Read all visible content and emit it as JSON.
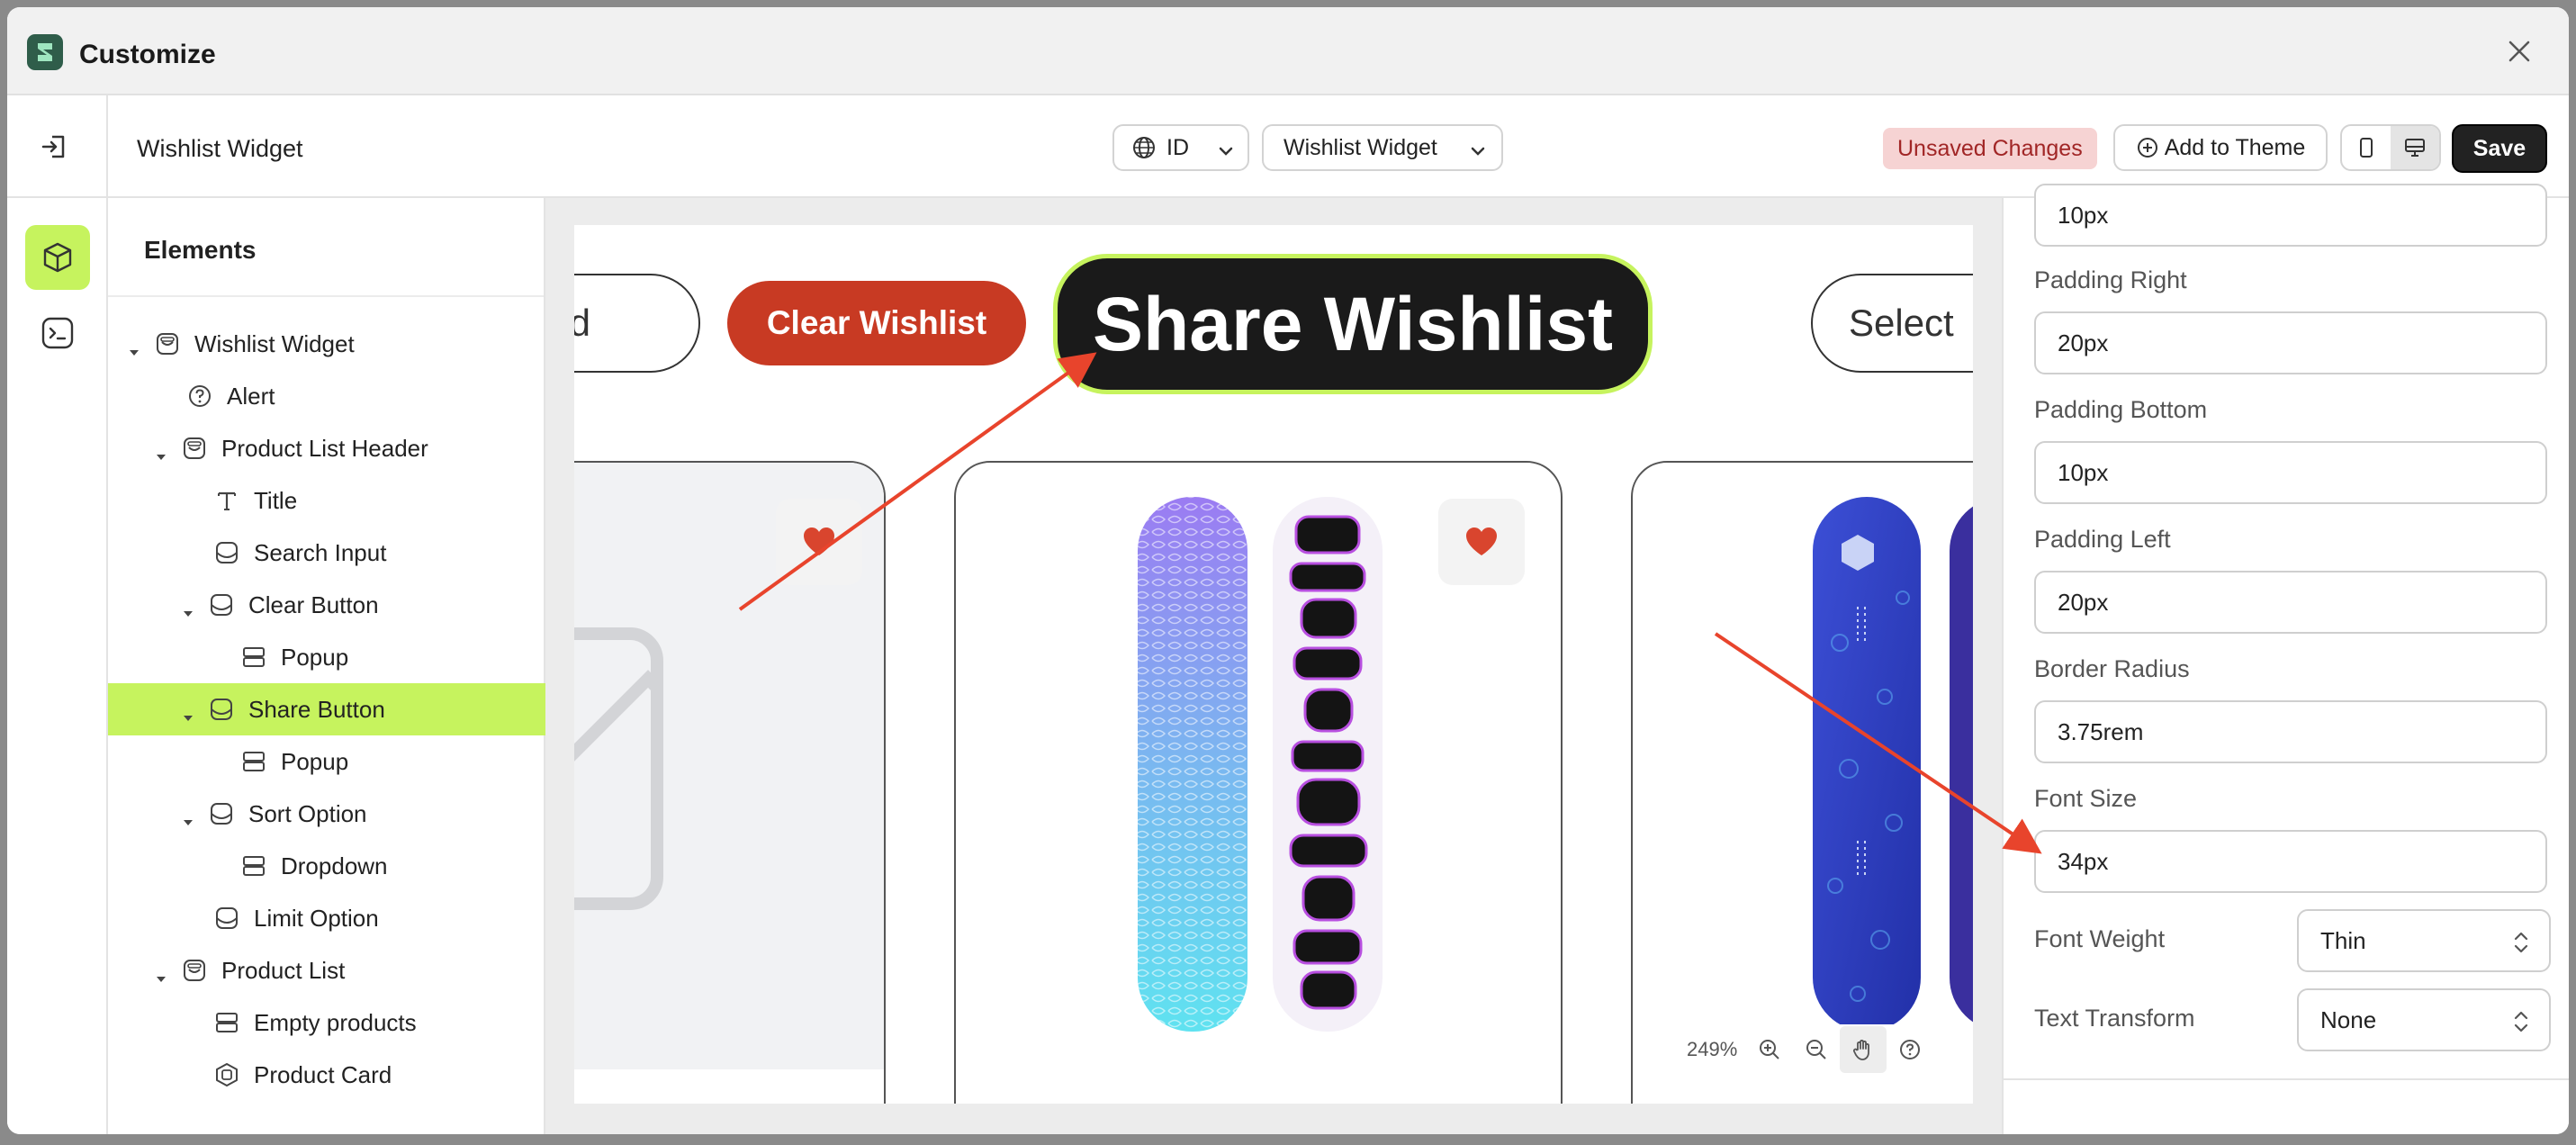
{
  "window": {
    "title": "Customize"
  },
  "topbar": {
    "heading": "Wishlist Widget",
    "language_value": "ID",
    "widget_value": "Wishlist Widget",
    "unsaved_label": "Unsaved Changes",
    "add_to_theme_label": "Add to Theme",
    "save_label": "Save"
  },
  "tree": {
    "title": "Elements",
    "items": [
      {
        "label": "Wishlist Widget",
        "icon": "widget-icon"
      },
      {
        "label": "Alert",
        "icon": "help-circle-icon"
      },
      {
        "label": "Product List Header",
        "icon": "section-icon"
      },
      {
        "label": "Title",
        "icon": "text-icon"
      },
      {
        "label": "Search Input",
        "icon": "block-icon"
      },
      {
        "label": "Clear Button",
        "icon": "block-icon"
      },
      {
        "label": "Popup",
        "icon": "layout-icon"
      },
      {
        "label": "Share Button",
        "icon": "block-icon",
        "selected": true
      },
      {
        "label": "Popup",
        "icon": "layout-icon"
      },
      {
        "label": "Sort Option",
        "icon": "block-icon"
      },
      {
        "label": "Dropdown",
        "icon": "layout-icon"
      },
      {
        "label": "Limit Option",
        "icon": "block-icon"
      },
      {
        "label": "Product List",
        "icon": "section-icon"
      },
      {
        "label": "Empty products",
        "icon": "layout-icon"
      },
      {
        "label": "Product Card",
        "icon": "card-icon"
      }
    ]
  },
  "canvas": {
    "search_partial_text": "d",
    "clear_button_label": "Clear Wishlist",
    "share_button_label": "Share Wishlist",
    "select_partial_text": "Select",
    "zoom_level": "249%"
  },
  "properties": {
    "padding_top_value": "10px",
    "padding_right_label": "Padding Right",
    "padding_right_value": "20px",
    "padding_bottom_label": "Padding Bottom",
    "padding_bottom_value": "10px",
    "padding_left_label": "Padding Left",
    "padding_left_value": "20px",
    "border_radius_label": "Border Radius",
    "border_radius_value": "3.75rem",
    "font_size_label": "Font Size",
    "font_size_value": "34px",
    "font_weight_label": "Font Weight",
    "font_weight_value": "Thin",
    "text_transform_label": "Text Transform",
    "text_transform_value": "None"
  },
  "colors": {
    "accent_lime": "#c6f35e",
    "clear_button_red": "#c83a23",
    "annotation_arrow": "#e8442c",
    "unsaved_badge_bg": "#f6d3d3"
  }
}
